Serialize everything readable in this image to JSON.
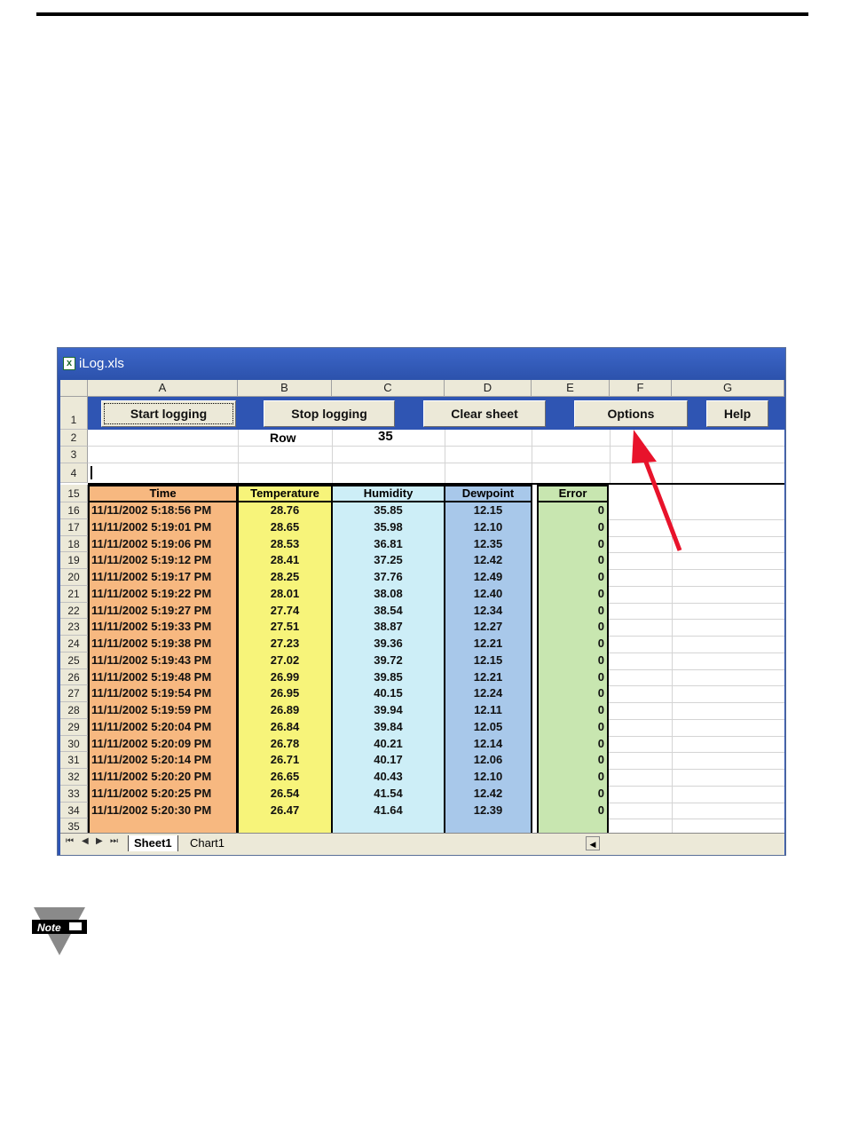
{
  "window": {
    "title": "iLog.xls"
  },
  "columns": [
    "A",
    "B",
    "C",
    "D",
    "E",
    "F",
    "G"
  ],
  "buttons": {
    "start": "Start logging",
    "stop": "Stop logging",
    "clear": "Clear sheet",
    "options": "Options",
    "help": "Help"
  },
  "row_counter": {
    "label": "Row",
    "value": "35"
  },
  "header_rows": [
    "1",
    "2",
    "3",
    "4"
  ],
  "table": {
    "header_row_num": "15",
    "headers": [
      "Time",
      "Temperature",
      "Humidity",
      "Dewpoint",
      "Error"
    ],
    "header_colors": [
      "#f7b880",
      "#f7f47a",
      "#cdeef7",
      "#a8c8ea",
      "#c8e6b0"
    ],
    "rows": [
      {
        "n": "16",
        "time": "11/11/2002  5:18:56 PM",
        "temp": "28.76",
        "hum": "35.85",
        "dew": "12.15",
        "err": "0"
      },
      {
        "n": "17",
        "time": "11/11/2002  5:19:01 PM",
        "temp": "28.65",
        "hum": "35.98",
        "dew": "12.10",
        "err": "0"
      },
      {
        "n": "18",
        "time": "11/11/2002  5:19:06 PM",
        "temp": "28.53",
        "hum": "36.81",
        "dew": "12.35",
        "err": "0"
      },
      {
        "n": "19",
        "time": "11/11/2002  5:19:12 PM",
        "temp": "28.41",
        "hum": "37.25",
        "dew": "12.42",
        "err": "0"
      },
      {
        "n": "20",
        "time": "11/11/2002  5:19:17 PM",
        "temp": "28.25",
        "hum": "37.76",
        "dew": "12.49",
        "err": "0"
      },
      {
        "n": "21",
        "time": "11/11/2002  5:19:22 PM",
        "temp": "28.01",
        "hum": "38.08",
        "dew": "12.40",
        "err": "0"
      },
      {
        "n": "22",
        "time": "11/11/2002  5:19:27 PM",
        "temp": "27.74",
        "hum": "38.54",
        "dew": "12.34",
        "err": "0"
      },
      {
        "n": "23",
        "time": "11/11/2002  5:19:33 PM",
        "temp": "27.51",
        "hum": "38.87",
        "dew": "12.27",
        "err": "0"
      },
      {
        "n": "24",
        "time": "11/11/2002  5:19:38 PM",
        "temp": "27.23",
        "hum": "39.36",
        "dew": "12.21",
        "err": "0"
      },
      {
        "n": "25",
        "time": "11/11/2002  5:19:43 PM",
        "temp": "27.02",
        "hum": "39.72",
        "dew": "12.15",
        "err": "0"
      },
      {
        "n": "26",
        "time": "11/11/2002  5:19:48 PM",
        "temp": "26.99",
        "hum": "39.85",
        "dew": "12.21",
        "err": "0"
      },
      {
        "n": "27",
        "time": "11/11/2002  5:19:54 PM",
        "temp": "26.95",
        "hum": "40.15",
        "dew": "12.24",
        "err": "0"
      },
      {
        "n": "28",
        "time": "11/11/2002  5:19:59 PM",
        "temp": "26.89",
        "hum": "39.94",
        "dew": "12.11",
        "err": "0"
      },
      {
        "n": "29",
        "time": "11/11/2002  5:20:04 PM",
        "temp": "26.84",
        "hum": "39.84",
        "dew": "12.05",
        "err": "0"
      },
      {
        "n": "30",
        "time": "11/11/2002  5:20:09 PM",
        "temp": "26.78",
        "hum": "40.21",
        "dew": "12.14",
        "err": "0"
      },
      {
        "n": "31",
        "time": "11/11/2002  5:20:14 PM",
        "temp": "26.71",
        "hum": "40.17",
        "dew": "12.06",
        "err": "0"
      },
      {
        "n": "32",
        "time": "11/11/2002  5:20:20 PM",
        "temp": "26.65",
        "hum": "40.43",
        "dew": "12.10",
        "err": "0"
      },
      {
        "n": "33",
        "time": "11/11/2002  5:20:25 PM",
        "temp": "26.54",
        "hum": "41.54",
        "dew": "12.42",
        "err": "0"
      },
      {
        "n": "34",
        "time": "11/11/2002  5:20:30 PM",
        "temp": "26.47",
        "hum": "41.64",
        "dew": "12.39",
        "err": "0"
      }
    ],
    "last_row_num": "35"
  },
  "sheet_tabs": [
    "Sheet1",
    "Chart1"
  ],
  "note": {
    "label": "Note",
    "icon": "pointing-hand-icon"
  },
  "colors": {
    "arrow": "#e8132b",
    "titlebar": "#2f55b3"
  }
}
